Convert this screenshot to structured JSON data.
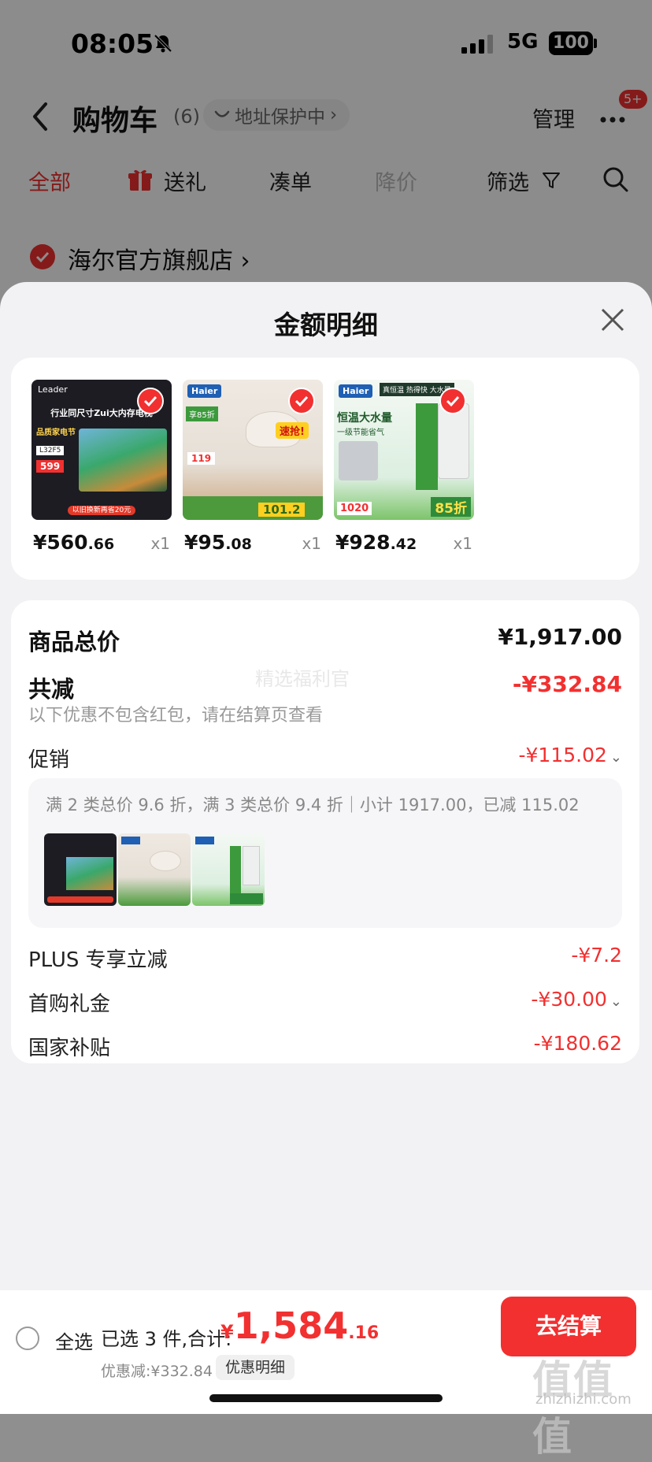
{
  "status_bar": {
    "time": "08:05",
    "network": "5G",
    "battery": "100"
  },
  "nav": {
    "title": "购物车",
    "count": "(6)",
    "address_pill": "地址保护中",
    "manage": "管理",
    "more_badge": "5+"
  },
  "tabs": [
    "全部",
    "送礼",
    "凑单",
    "降价",
    "筛选"
  ],
  "store": {
    "name": "海尔官方旗舰店"
  },
  "sheet": {
    "title": "金额明细",
    "products": [
      {
        "price_int": "¥560",
        "price_dec": ".66",
        "qty": "x1",
        "brand": "Leader",
        "headline": "行业同尺寸Zui大内存电视",
        "tag": "品质家电节",
        "model": "L32F5",
        "promo_price": "599",
        "footer": "以旧换新再省20元",
        "colors": {
          "bg": "#1c1c22",
          "accent": "#3aa86b"
        }
      },
      {
        "price_int": "¥95",
        "price_dec": ".08",
        "qty": "x1",
        "brand": "Haier",
        "headline": "速抢!",
        "tag": "享85折",
        "promo_price": "119",
        "footer_price": "101.2",
        "colors": {
          "bg": "#eae4dc",
          "accent": "#3c9a3c"
        }
      },
      {
        "price_int": "¥928",
        "price_dec": ".42",
        "qty": "x1",
        "brand": "Haier",
        "headline": "恒温大水量",
        "subline": "一级节能省气",
        "tag": "真恒温 热得快 大水量",
        "promo_price": "1020",
        "footer": "85折",
        "colors": {
          "bg": "#dcefe0",
          "accent": "#2e8b3a"
        }
      }
    ],
    "summary": {
      "total_label": "商品总价",
      "total_value": "¥1,917.00",
      "reduce_label": "共减",
      "reduce_value": "-¥332.84",
      "note": "以下优惠不包含红包，请在结算页查看",
      "center_watermark": "精选福利官",
      "promo_label": "促销",
      "promo_value": "-¥115.02",
      "promo_desc": "满 2 类总价 9.6 折，满 3 类总价 9.4 折｜小计 1917.00，已减 115.02",
      "plus_label": "PLUS 专享立减",
      "plus_value": "-¥7.2",
      "first_label": "首购礼金",
      "first_value": "-¥30.00",
      "subsidy_label": "国家补贴",
      "subsidy_value": "-¥180.62"
    }
  },
  "bottom_bar": {
    "select_all": "全选",
    "selected": "已选 3 件,合计:",
    "currency": "¥",
    "total_int": "1,584",
    "total_dec": ".16",
    "discount": "优惠减:¥332.84",
    "detail_btn": "优惠明细",
    "checkout": "去结算"
  },
  "watermark": {
    "mark": "值值值",
    "url": "zhizhizhi.com"
  },
  "colors": {
    "accent_red": "#f23030",
    "sheet_bg": "#f2f2f4"
  }
}
